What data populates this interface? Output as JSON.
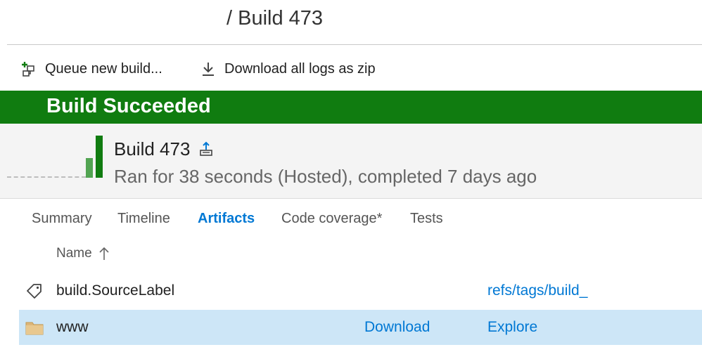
{
  "header": {
    "breadcrumb": "/ Build 473"
  },
  "toolbar": {
    "queue_label": "Queue new build...",
    "download_logs_label": "Download all logs as zip"
  },
  "banner": {
    "status_text": "Build Succeeded",
    "color": "#107c10"
  },
  "build": {
    "title": "Build 473",
    "subtitle": "Ran for 38 seconds (Hosted), completed 7 days ago"
  },
  "tabs": [
    {
      "label": "Summary",
      "active": false
    },
    {
      "label": "Timeline",
      "active": false
    },
    {
      "label": "Artifacts",
      "active": true
    },
    {
      "label": "Code coverage*",
      "active": false
    },
    {
      "label": "Tests",
      "active": false
    }
  ],
  "artifacts": {
    "column_name": "Name",
    "sort": "ascending",
    "rows": [
      {
        "icon": "tag-icon",
        "name": "build.SourceLabel",
        "download": "",
        "explore": "refs/tags/build_",
        "selected": false
      },
      {
        "icon": "folder-icon",
        "name": "www",
        "download": "Download",
        "explore": "Explore",
        "selected": true
      }
    ]
  },
  "colors": {
    "accent": "#0078d4",
    "success": "#107c10",
    "selection": "#cde6f7"
  }
}
